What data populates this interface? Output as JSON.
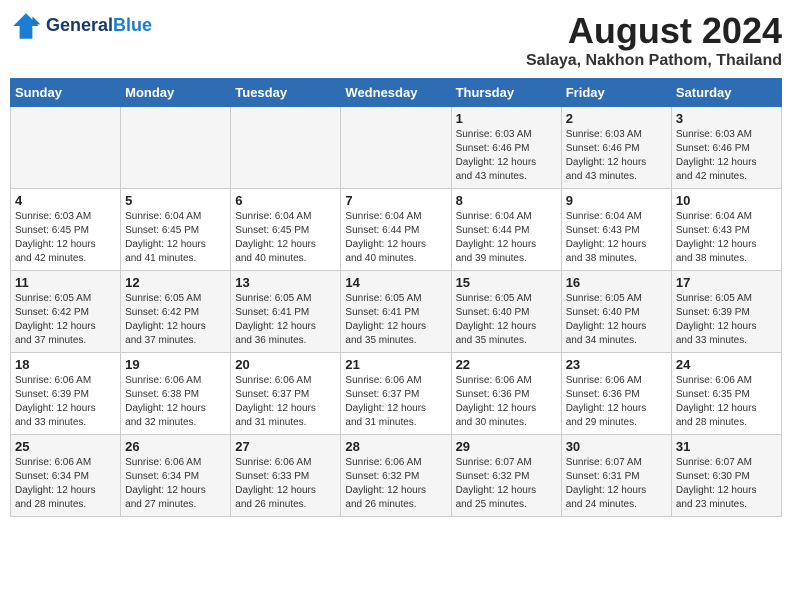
{
  "header": {
    "logo_line1": "General",
    "logo_line2": "Blue",
    "month_year": "August 2024",
    "location": "Salaya, Nakhon Pathom, Thailand"
  },
  "weekdays": [
    "Sunday",
    "Monday",
    "Tuesday",
    "Wednesday",
    "Thursday",
    "Friday",
    "Saturday"
  ],
  "weeks": [
    [
      {
        "day": "",
        "info": ""
      },
      {
        "day": "",
        "info": ""
      },
      {
        "day": "",
        "info": ""
      },
      {
        "day": "",
        "info": ""
      },
      {
        "day": "1",
        "info": "Sunrise: 6:03 AM\nSunset: 6:46 PM\nDaylight: 12 hours\nand 43 minutes."
      },
      {
        "day": "2",
        "info": "Sunrise: 6:03 AM\nSunset: 6:46 PM\nDaylight: 12 hours\nand 43 minutes."
      },
      {
        "day": "3",
        "info": "Sunrise: 6:03 AM\nSunset: 6:46 PM\nDaylight: 12 hours\nand 42 minutes."
      }
    ],
    [
      {
        "day": "4",
        "info": "Sunrise: 6:03 AM\nSunset: 6:45 PM\nDaylight: 12 hours\nand 42 minutes."
      },
      {
        "day": "5",
        "info": "Sunrise: 6:04 AM\nSunset: 6:45 PM\nDaylight: 12 hours\nand 41 minutes."
      },
      {
        "day": "6",
        "info": "Sunrise: 6:04 AM\nSunset: 6:45 PM\nDaylight: 12 hours\nand 40 minutes."
      },
      {
        "day": "7",
        "info": "Sunrise: 6:04 AM\nSunset: 6:44 PM\nDaylight: 12 hours\nand 40 minutes."
      },
      {
        "day": "8",
        "info": "Sunrise: 6:04 AM\nSunset: 6:44 PM\nDaylight: 12 hours\nand 39 minutes."
      },
      {
        "day": "9",
        "info": "Sunrise: 6:04 AM\nSunset: 6:43 PM\nDaylight: 12 hours\nand 38 minutes."
      },
      {
        "day": "10",
        "info": "Sunrise: 6:04 AM\nSunset: 6:43 PM\nDaylight: 12 hours\nand 38 minutes."
      }
    ],
    [
      {
        "day": "11",
        "info": "Sunrise: 6:05 AM\nSunset: 6:42 PM\nDaylight: 12 hours\nand 37 minutes."
      },
      {
        "day": "12",
        "info": "Sunrise: 6:05 AM\nSunset: 6:42 PM\nDaylight: 12 hours\nand 37 minutes."
      },
      {
        "day": "13",
        "info": "Sunrise: 6:05 AM\nSunset: 6:41 PM\nDaylight: 12 hours\nand 36 minutes."
      },
      {
        "day": "14",
        "info": "Sunrise: 6:05 AM\nSunset: 6:41 PM\nDaylight: 12 hours\nand 35 minutes."
      },
      {
        "day": "15",
        "info": "Sunrise: 6:05 AM\nSunset: 6:40 PM\nDaylight: 12 hours\nand 35 minutes."
      },
      {
        "day": "16",
        "info": "Sunrise: 6:05 AM\nSunset: 6:40 PM\nDaylight: 12 hours\nand 34 minutes."
      },
      {
        "day": "17",
        "info": "Sunrise: 6:05 AM\nSunset: 6:39 PM\nDaylight: 12 hours\nand 33 minutes."
      }
    ],
    [
      {
        "day": "18",
        "info": "Sunrise: 6:06 AM\nSunset: 6:39 PM\nDaylight: 12 hours\nand 33 minutes."
      },
      {
        "day": "19",
        "info": "Sunrise: 6:06 AM\nSunset: 6:38 PM\nDaylight: 12 hours\nand 32 minutes."
      },
      {
        "day": "20",
        "info": "Sunrise: 6:06 AM\nSunset: 6:37 PM\nDaylight: 12 hours\nand 31 minutes."
      },
      {
        "day": "21",
        "info": "Sunrise: 6:06 AM\nSunset: 6:37 PM\nDaylight: 12 hours\nand 31 minutes."
      },
      {
        "day": "22",
        "info": "Sunrise: 6:06 AM\nSunset: 6:36 PM\nDaylight: 12 hours\nand 30 minutes."
      },
      {
        "day": "23",
        "info": "Sunrise: 6:06 AM\nSunset: 6:36 PM\nDaylight: 12 hours\nand 29 minutes."
      },
      {
        "day": "24",
        "info": "Sunrise: 6:06 AM\nSunset: 6:35 PM\nDaylight: 12 hours\nand 28 minutes."
      }
    ],
    [
      {
        "day": "25",
        "info": "Sunrise: 6:06 AM\nSunset: 6:34 PM\nDaylight: 12 hours\nand 28 minutes."
      },
      {
        "day": "26",
        "info": "Sunrise: 6:06 AM\nSunset: 6:34 PM\nDaylight: 12 hours\nand 27 minutes."
      },
      {
        "day": "27",
        "info": "Sunrise: 6:06 AM\nSunset: 6:33 PM\nDaylight: 12 hours\nand 26 minutes."
      },
      {
        "day": "28",
        "info": "Sunrise: 6:06 AM\nSunset: 6:32 PM\nDaylight: 12 hours\nand 26 minutes."
      },
      {
        "day": "29",
        "info": "Sunrise: 6:07 AM\nSunset: 6:32 PM\nDaylight: 12 hours\nand 25 minutes."
      },
      {
        "day": "30",
        "info": "Sunrise: 6:07 AM\nSunset: 6:31 PM\nDaylight: 12 hours\nand 24 minutes."
      },
      {
        "day": "31",
        "info": "Sunrise: 6:07 AM\nSunset: 6:30 PM\nDaylight: 12 hours\nand 23 minutes."
      }
    ]
  ]
}
